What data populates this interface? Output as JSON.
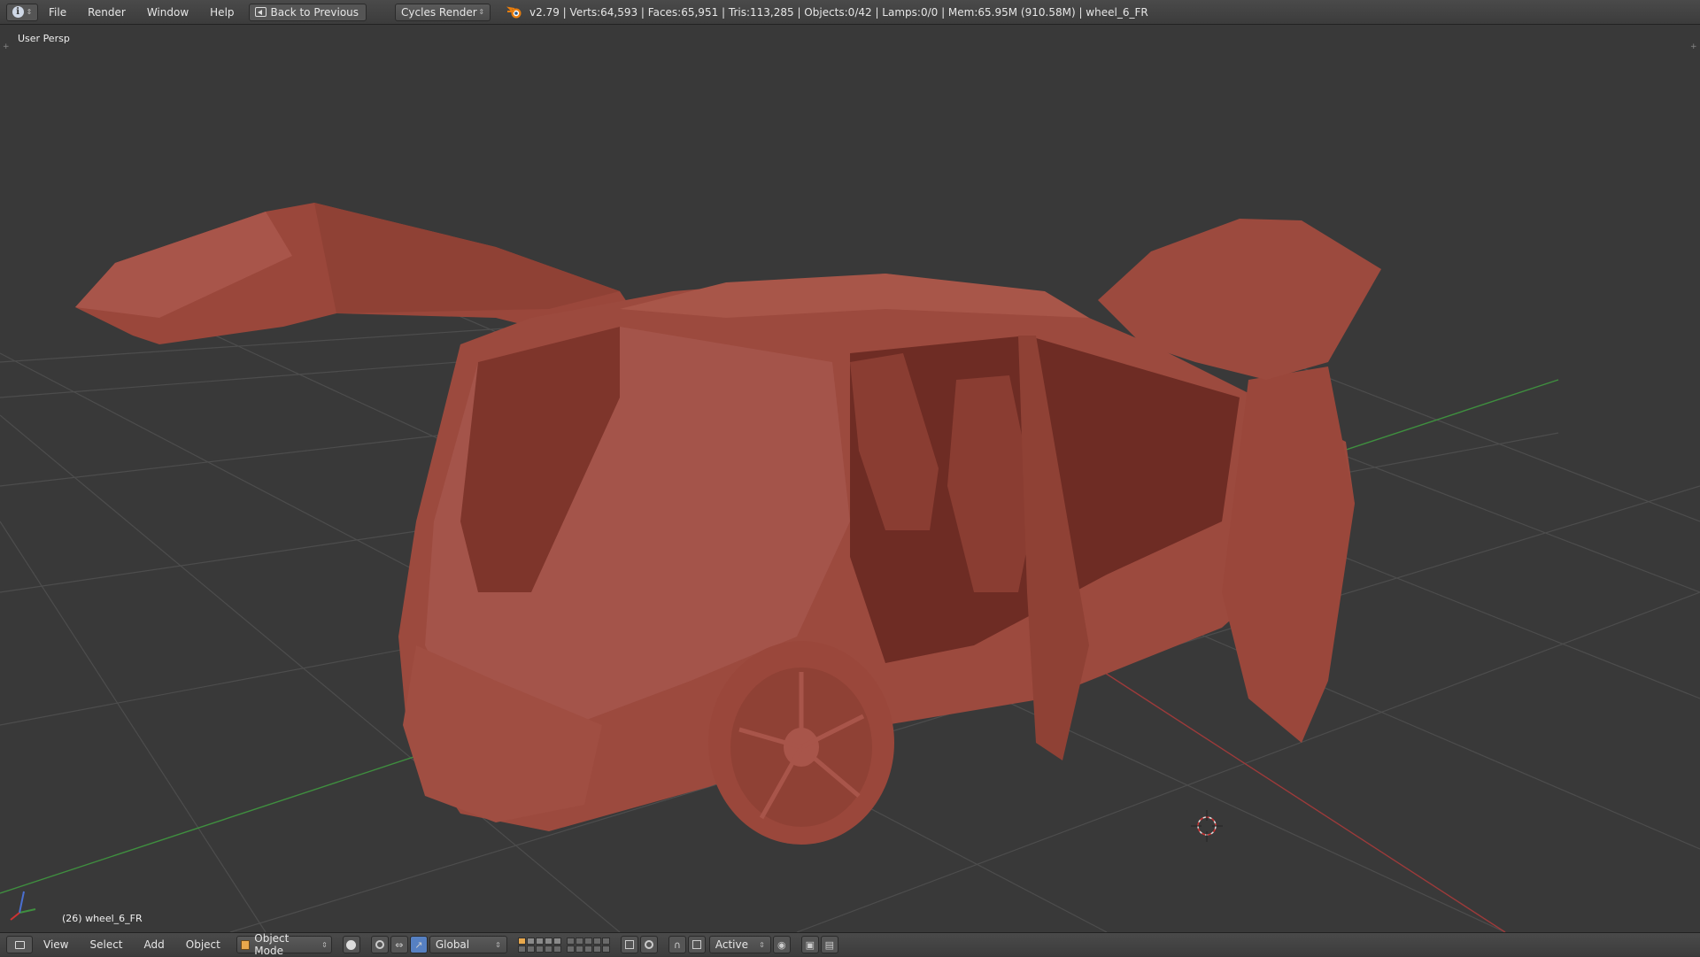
{
  "topbar": {
    "menus": [
      "File",
      "Render",
      "Window",
      "Help"
    ],
    "back_label": "Back to Previous",
    "render_engine": "Cycles Render",
    "stats": "v2.79 | Verts:64,593 | Faces:65,951 | Tris:113,285 | Objects:0/42 | Lamps:0/0 | Mem:65.95M (910.58M) | wheel_6_FR"
  },
  "viewport": {
    "view_label": "User Persp",
    "object_label": "(26) wheel_6_FR",
    "model_color": "#9c4a3e",
    "grid_color": "#4e4e4e",
    "x_axis_color": "#9c3a3a",
    "y_axis_color": "#3f8f3f"
  },
  "bottombar": {
    "menus": [
      "View",
      "Select",
      "Add",
      "Object"
    ],
    "mode": "Object Mode",
    "orientation": "Global",
    "pivot_mode": "Active"
  },
  "icons": {
    "editor_type": "info-icon",
    "back": "screen-back-icon",
    "blender": "blender-logo-icon",
    "viewport_shading": "solid-shading-icon",
    "cursor": "3d-cursor-icon"
  }
}
